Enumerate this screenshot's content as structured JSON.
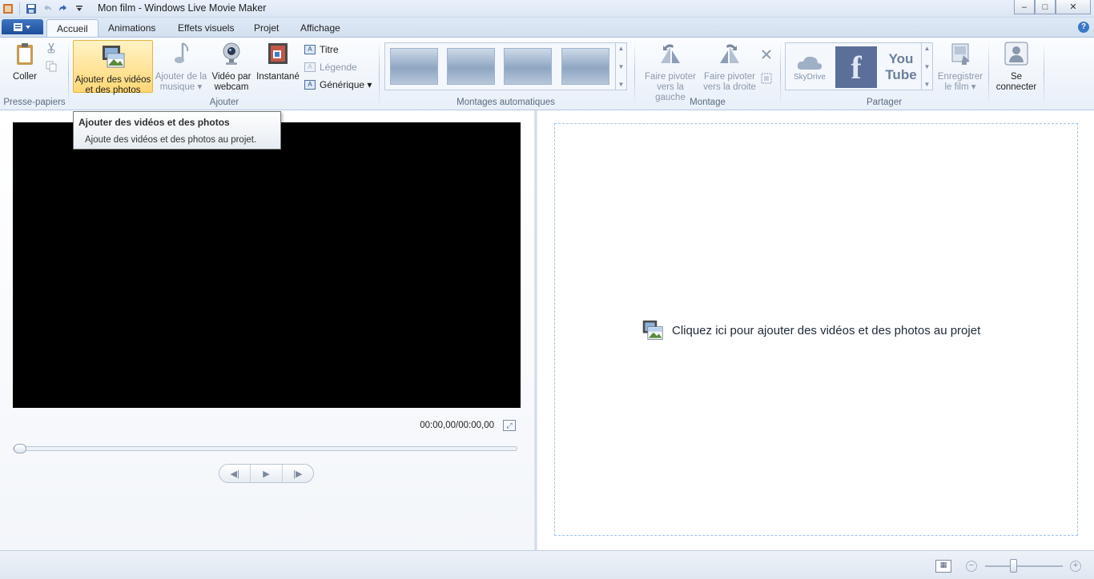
{
  "window": {
    "title": "Mon film - Windows Live Movie Maker",
    "minimize": "‒",
    "maximize": "□",
    "close": "✕"
  },
  "qat": {
    "save_icon": "save-icon",
    "undo_icon": "undo-icon",
    "redo_icon": "redo-icon",
    "customize_icon": "chevron-down-icon"
  },
  "tabs": [
    {
      "label": "Accueil",
      "active": true
    },
    {
      "label": "Animations"
    },
    {
      "label": "Effets visuels"
    },
    {
      "label": "Projet"
    },
    {
      "label": "Affichage"
    }
  ],
  "ribbon": {
    "clipboard": {
      "paste_label": "Coller",
      "group": "Presse-papiers"
    },
    "add": {
      "group": "Ajouter",
      "add_media_line1": "Ajouter des vidéos",
      "add_media_line2": "et des photos",
      "add_music_line1": "Ajouter de la",
      "add_music_line2": "musique ▾",
      "webcam_line1": "Vidéo par",
      "webcam_line2": "webcam",
      "snapshot": "Instantané",
      "title": "Titre",
      "caption": "Légende",
      "credits": "Générique ▾"
    },
    "automovie": {
      "group": "Montages automatiques"
    },
    "editing": {
      "group": "Montage",
      "rotate_left_line1": "Faire pivoter",
      "rotate_left_line2": "vers la gauche",
      "rotate_right_line1": "Faire pivoter",
      "rotate_right_line2": "vers la droite"
    },
    "share": {
      "group": "Partager",
      "skydrive": "SkyDrive",
      "facebook": "f",
      "youtube_line1": "You",
      "youtube_line2": "Tube",
      "save_movie_line1": "Enregistrer",
      "save_movie_line2": "le film ▾"
    },
    "signin": {
      "line1": "Se",
      "line2": "connecter"
    }
  },
  "tooltip": {
    "title": "Ajouter des vidéos et des photos",
    "body": "Ajoute des vidéos et des photos au projet."
  },
  "preview": {
    "time": "00:00,00/00:00,00",
    "playback_position": 0,
    "prev_frame": "◀|",
    "play": "▶",
    "next_frame": "|▶"
  },
  "storyboard": {
    "prompt": "Cliquez ici pour ajouter des vidéos et des photos au projet"
  },
  "statusbar": {
    "zoom_out": "−",
    "zoom_in": "+",
    "zoom_level": 0.37
  }
}
